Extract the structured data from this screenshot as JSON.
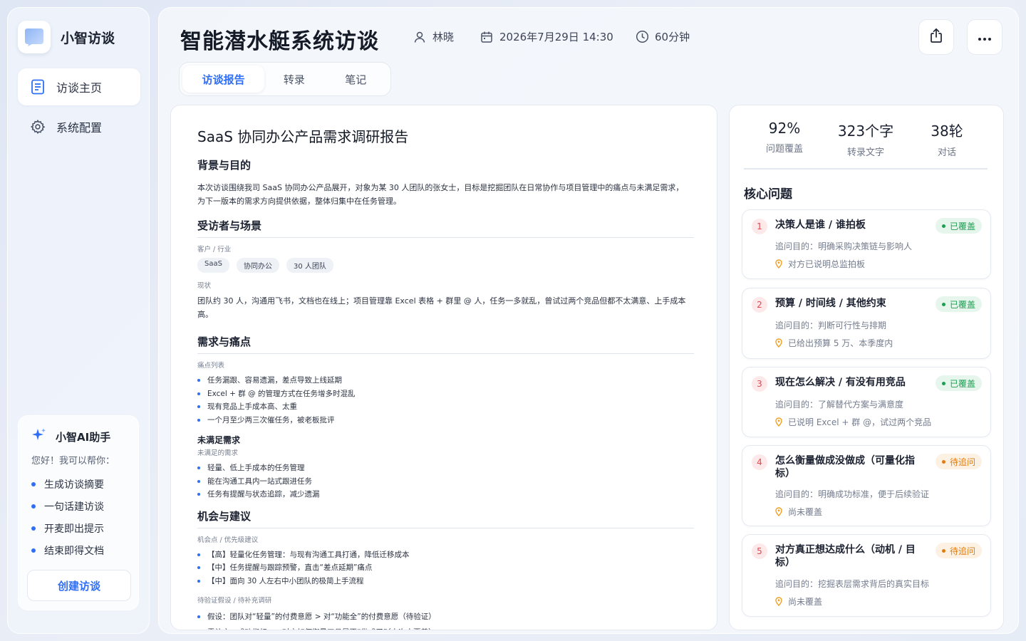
{
  "brand": {
    "name": "小智访谈",
    "logo_icon": "brand-logo-icon"
  },
  "nav": {
    "items": [
      {
        "label": "访谈主页",
        "icon": "document-icon",
        "active": true
      },
      {
        "label": "系统配置",
        "icon": "gear-icon",
        "active": false
      }
    ]
  },
  "assistant": {
    "title": "小智AI助手",
    "greeting": "您好！我可以帮你：",
    "items": [
      "生成访谈摘要",
      "一句话建访谈",
      "开麦即出提示",
      "结束即得文档"
    ],
    "create_label": "创建访谈"
  },
  "header": {
    "title": "智能潜水艇系统访谈",
    "interviewer": "林晓",
    "datetime": "2026年7月29日 14:30",
    "duration": "60分钟"
  },
  "tabs": [
    "访谈报告",
    "转录",
    "笔记"
  ],
  "report": {
    "title": "SaaS 协同办公产品需求调研报告",
    "sections": {
      "background": {
        "heading": "背景与目的",
        "text_line1": "本次访谈围绕我司 SaaS 协同办公产品展开，对象为某 30 人团队的张女士，目标是挖掘团队在日常协作与项目管理中的痛点与未满足需求，",
        "text_line2": "为下一版本的需求方向提供依据，整体归集中在任务管理。"
      },
      "persona": {
        "heading": "受访者与场景",
        "client_label": "客户 / 行业",
        "chips": [
          "SaaS",
          "协同办公",
          "30 人团队"
        ],
        "status_label": "现状",
        "status_text": "团队约 30 人，沟通用飞书，文档也在线上；项目管理靠 Excel 表格 + 群里 @ 人，任务一多就乱，曾试过两个竞品但都不太满意、上手成本高。"
      },
      "pain": {
        "heading": "需求与痛点",
        "list_label": "痛点列表",
        "items": [
          "任务漏跟、容易遗漏，差点导致上线延期",
          "Excel + 群 @ 的管理方式在任务增多时混乱",
          "现有竞品上手成本高、太重",
          "一个月至少两三次催任务，被老板批评"
        ],
        "unmet_heading": "未满足需求",
        "unmet_label": "未满足的需求",
        "unmet_items": [
          "轻量、低上手成本的任务管理",
          "能在沟通工具内一站式跟进任务",
          "任务有提醒与状态追踪，减少遗漏"
        ]
      },
      "opportunity": {
        "heading": "机会与建议",
        "label": "机会点 / 优先级建议",
        "items": [
          "【高】轻量化任务管理：与现有沟通工具打通，降低迁移成本",
          "【中】任务提醒与跟踪预警，直击“差点延期”痛点",
          "【中】面向 30 人左右中小团队的极简上手流程"
        ],
        "pending_label": "待验证假设 / 待补充调研",
        "pending_items": [
          "假设：团队对“轻量”的付费意愿 > 对“功能全”的付费意愿（待验证）",
          "需补充：成功指标——对方如何衡量工具是否“做成了”（本次未覆盖）"
        ]
      }
    }
  },
  "stats": [
    {
      "value": "92%",
      "label": "问题覆盖"
    },
    {
      "value": "323个字",
      "label": "转录文字"
    },
    {
      "value": "38轮",
      "label": "对话"
    }
  ],
  "core": {
    "title": "核心问题",
    "questions": [
      {
        "num": "1",
        "title": "决策人是谁 / 谁拍板",
        "badge": "已覆盖",
        "status": "ok",
        "purpose": "追问目的：明确采购决策链与影响人",
        "note": "对方已说明总监拍板"
      },
      {
        "num": "2",
        "title": "预算 / 时间线 / 其他约束",
        "badge": "已覆盖",
        "status": "ok",
        "purpose": "追问目的：判断可行性与排期",
        "note": "已给出预算 5 万、本季度内"
      },
      {
        "num": "3",
        "title": "现在怎么解决 / 有没有用竞品",
        "badge": "已覆盖",
        "status": "ok",
        "purpose": "追问目的：了解替代方案与满意度",
        "note": "已说明 Excel + 群 @，试过两个竞品"
      },
      {
        "num": "4",
        "title": "怎么衡量做成没做成（可量化指标）",
        "badge": "待追问",
        "status": "wait",
        "purpose": "追问目的：明确成功标准，便于后续验证",
        "note": "尚未覆盖"
      },
      {
        "num": "5",
        "title": "对方真正想达成什么（动机 / 目标）",
        "badge": "待追问",
        "status": "wait",
        "purpose": "追问目的：挖掘表层需求背后的真实目标",
        "note": "尚未覆盖"
      }
    ]
  },
  "colors": {
    "accent": "#2f6ef6",
    "covered": "#1e9e52",
    "pending": "#e07d12",
    "number": "#e0474f"
  },
  "icons": [
    "user-icon",
    "calendar-icon",
    "clock-icon",
    "share-icon",
    "more-icon",
    "sparkle-icon",
    "pin-icon"
  ]
}
